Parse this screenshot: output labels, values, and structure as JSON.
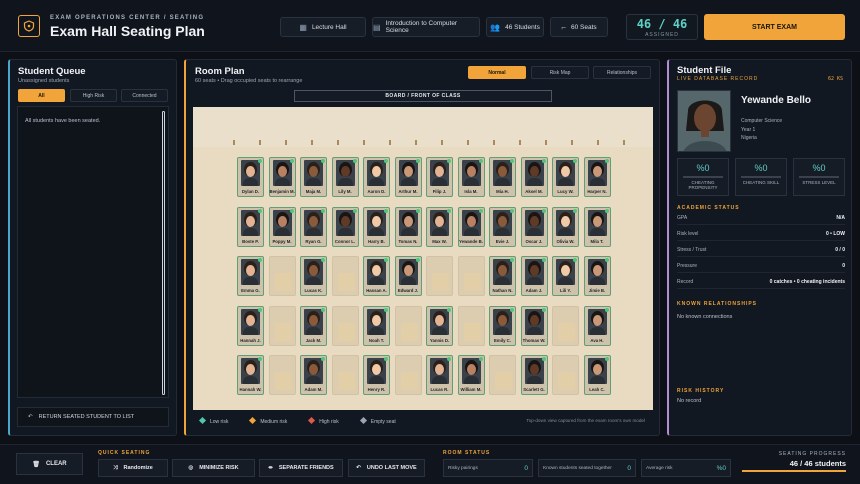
{
  "header": {
    "subtitle": "EXAM OPERATIONS CENTER / SEATING",
    "title": "Exam Hall Seating Plan",
    "chips": [
      {
        "icon": "building-icon",
        "label": "Lecture Hall"
      },
      {
        "icon": "book-icon",
        "label": "Introduction to Computer Science"
      },
      {
        "icon": "users-icon",
        "label": "46 Students"
      },
      {
        "icon": "seat-icon",
        "label": "60 Seats"
      }
    ],
    "assigned_value": "46 / 46",
    "assigned_label": "ASSIGNED",
    "start_label": "START EXAM"
  },
  "queue": {
    "title": "Student Queue",
    "subtitle": "Unassigned students",
    "filters": [
      "All",
      "High Risk",
      "Connected"
    ],
    "active_filter": "All",
    "empty_message": "All students have been seated.",
    "return_label": "RETURN SEATED STUDENT TO LIST"
  },
  "room": {
    "title": "Room Plan",
    "subtitle": "60 seats  •  Drag occupied seats to rearrange",
    "views": [
      "Normal",
      "Risk Map",
      "Relationships"
    ],
    "active_view": "Normal",
    "board_label": "BOARD  /  FRONT OF CLASS",
    "rows": [
      [
        "Dylan D.",
        "Benjamin M.",
        "Maja M.",
        "Lily M.",
        "Aaron D.",
        "Arthur M.",
        "Filip J.",
        "Isla M.",
        "Mia H.",
        "Aksel M.",
        "Lucy W.",
        "Harper N."
      ],
      [
        "Boste P.",
        "Poppy M.",
        "Ryan G.",
        "Connor L.",
        "Harry B.",
        "Tomas N.",
        "Max W.",
        "Yewande B.",
        "Evie J.",
        "Oscar J.",
        "Olivia W.",
        "Mila T."
      ],
      [
        "Emma G.",
        "",
        "Lucas K.",
        "",
        "Hassan A.",
        "Edward J.",
        "",
        "",
        "Nathan N.",
        "Adam J.",
        "Lili Y.",
        "Jimie B."
      ],
      [
        "Hannah J.",
        "",
        "Jack M.",
        "",
        "Noah T.",
        "",
        "Yannis D.",
        "",
        "Emily C.",
        "Thomas W.",
        "",
        "Ava H."
      ],
      [
        "Hannah W.",
        "",
        "Adam M.",
        "",
        "Henry R.",
        "",
        "Lucas R.",
        "William M.",
        "",
        "Scarlett G.",
        "",
        "Leah C."
      ]
    ],
    "legend": [
      {
        "label": "Low risk",
        "color": "#4fc7a8"
      },
      {
        "label": "Medium risk",
        "color": "#f0a43a"
      },
      {
        "label": "High risk",
        "color": "#e0584a"
      },
      {
        "label": "Empty seat",
        "color": "#9aa5b3"
      }
    ],
    "caption": "Top-down view captured from the exam room's own model"
  },
  "student": {
    "title": "Student File",
    "live_label": "LIVE DATABASE RECORD",
    "live_ks": "62 KS",
    "name": "Yewande Bello",
    "program": "Computer Science",
    "year": "Year 1",
    "country": "Nigeria",
    "stats": [
      {
        "value": "%0",
        "label": "CHEATING PROPENSITY"
      },
      {
        "value": "%0",
        "label": "CHEATING SKILL"
      },
      {
        "value": "%0",
        "label": "STRESS LEVEL"
      }
    ],
    "academic_label": "ACADEMIC STATUS",
    "academic": [
      {
        "label": "GPA",
        "value": "N/A"
      },
      {
        "label": "Risk level",
        "value": "0  •  LOW"
      },
      {
        "label": "Stress / Trust",
        "value": "0  /  0"
      },
      {
        "label": "Pressure",
        "value": "0"
      },
      {
        "label": "Record",
        "value": "0 catches  •  0 cheating incidents"
      }
    ],
    "relationships_label": "KNOWN RELATIONSHIPS",
    "relationships_text": "No known connections",
    "history_label": "RISK HISTORY",
    "history_text": "No record"
  },
  "footer": {
    "clear_label": "CLEAR",
    "quick_label": "QUICK SEATING",
    "quick_buttons": [
      "Randomize",
      "MINIMIZE RISK",
      "SEPARATE FRIENDS",
      "UNDO LAST MOVE"
    ],
    "status_label": "ROOM STATUS",
    "status": [
      {
        "label": "Risky pairings",
        "value": "0"
      },
      {
        "label": "Known students seated together",
        "value": "0"
      },
      {
        "label": "Average risk",
        "value": "%0"
      }
    ],
    "progress_label": "SEATING PROGRESS",
    "progress_value": "46 / 46 students",
    "progress_fraction": 1.0
  },
  "colors": {
    "accent": "#f0a43a",
    "teal": "#5fd0c8",
    "bg": "#0d1117"
  }
}
